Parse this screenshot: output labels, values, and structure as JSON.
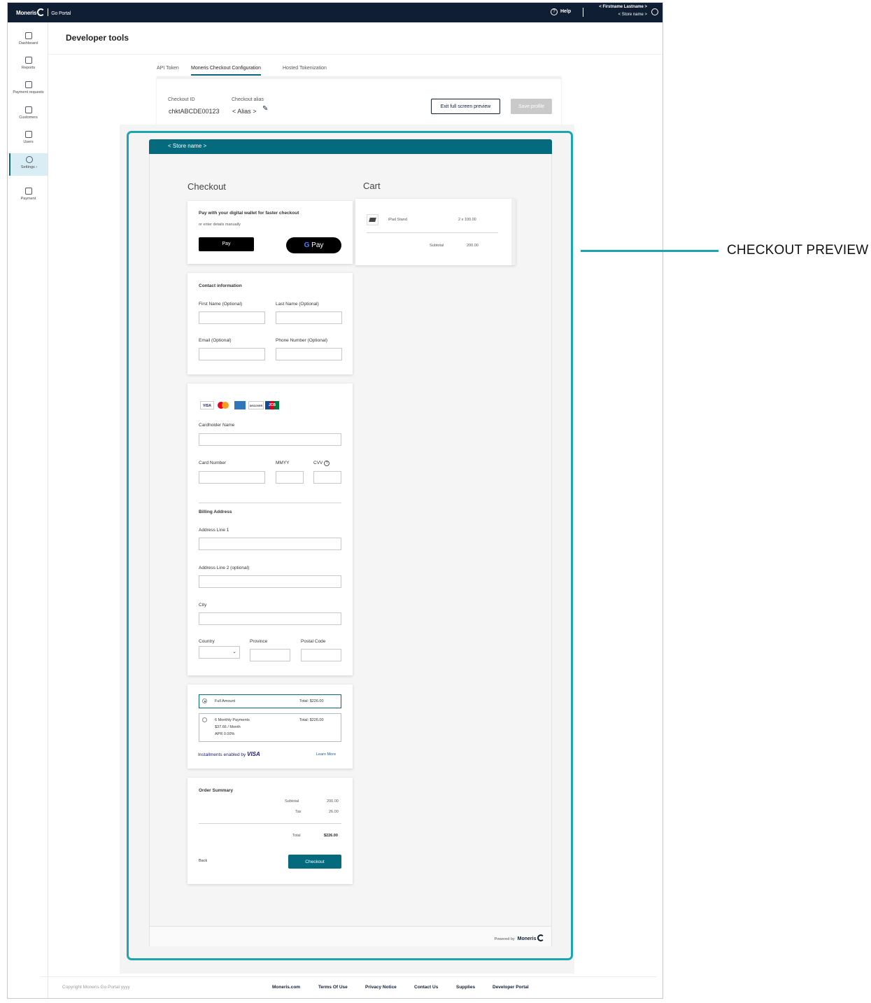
{
  "app": {
    "brand": "Moneris",
    "portal": "Go Portal"
  },
  "topbar": {
    "help": "Help",
    "user_name": "< Firstname Lastname >",
    "store_name": "< Store name >"
  },
  "sidebar": {
    "items": [
      {
        "label": "Dashboard",
        "icon": "dashboard-icon"
      },
      {
        "label": "Reports",
        "icon": "reports-icon"
      },
      {
        "label": "Payment requests",
        "icon": "payment-requests-icon"
      },
      {
        "label": "Customers",
        "icon": "customers-icon"
      },
      {
        "label": "Users",
        "icon": "users-icon"
      },
      {
        "label": "Settings",
        "icon": "settings-icon"
      },
      {
        "label": "Payment",
        "icon": "payment-icon"
      }
    ]
  },
  "header": {
    "title": "Developer tools"
  },
  "tabs": [
    "API Token",
    "Moneris Checkout Configuration",
    "Hosted Tokenization"
  ],
  "config": {
    "checkout_id_label": "Checkout ID",
    "checkout_id": "chktABCDE00123",
    "alias_label": "Checkout alias",
    "alias": "< Alias >",
    "exit_button": "Exit full screen preview",
    "save_button": "Save profile"
  },
  "preview": {
    "store_name": "< Store name >",
    "checkout_title": "Checkout",
    "cart_title": "Cart",
    "wallet": {
      "title": "Pay with your digital wallet for faster checkout",
      "subtitle": "or enter details manually",
      "apple_pay": "Pay",
      "google_pay": "Pay"
    },
    "contact": {
      "title": "Contact information",
      "first_name": "First Name (Optional)",
      "last_name": "Last Name (Optional)",
      "email": "Email (Optional)",
      "phone": "Phone Number (Optional)"
    },
    "card": {
      "brands": [
        "VISA",
        "Mastercard",
        "AMEX",
        "DISCOVER",
        "JCB"
      ],
      "cardholder": "Cardholder Name",
      "card_number": "Card Number",
      "mmyy": "MMYY",
      "cvv": "CVV"
    },
    "billing": {
      "title": "Billing Address",
      "address1": "Address Line 1",
      "address2": "Address Line 2 (optional)",
      "city": "City",
      "country": "Country",
      "province": "Province",
      "postal": "Postal Code"
    },
    "installments": {
      "full_label": "Full Amount",
      "full_total": "Total: $226.00",
      "monthly_label": "6 Monthly Payments",
      "monthly_amount": "$37.66 / Month",
      "monthly_apr": "APR 0.00%",
      "monthly_total": "Total: $226.00",
      "enabled_by": "Installments enabled by",
      "visa": "VISA",
      "learn_more": "Learn More"
    },
    "summary": {
      "title": "Order Summary",
      "subtotal_label": "Subtotal",
      "subtotal": "200.00",
      "tax_label": "Tax",
      "tax": "26.00",
      "total_label": "Total",
      "total": "$226.00",
      "back": "Back",
      "checkout_button": "Checkout"
    },
    "cart": {
      "item": "iPad Stand",
      "qty_price": "2 x 100.00",
      "subtotal_label": "Subtotal",
      "subtotal": "200.00"
    },
    "powered_by": "Powered by",
    "powered_brand": "Moneris"
  },
  "annotation": "CHECKOUT PREVIEW",
  "footer": {
    "copyright": "Copyright Moneris Go Portal yyyy",
    "links": [
      "Moneris.com",
      "Terms Of Use",
      "Privacy Notice",
      "Contact Us",
      "Supplies",
      "Developer Portal"
    ]
  },
  "colors": {
    "nav_dark": "#0f1e33",
    "teal": "#056a7d",
    "highlight": "#1aa5b0"
  }
}
